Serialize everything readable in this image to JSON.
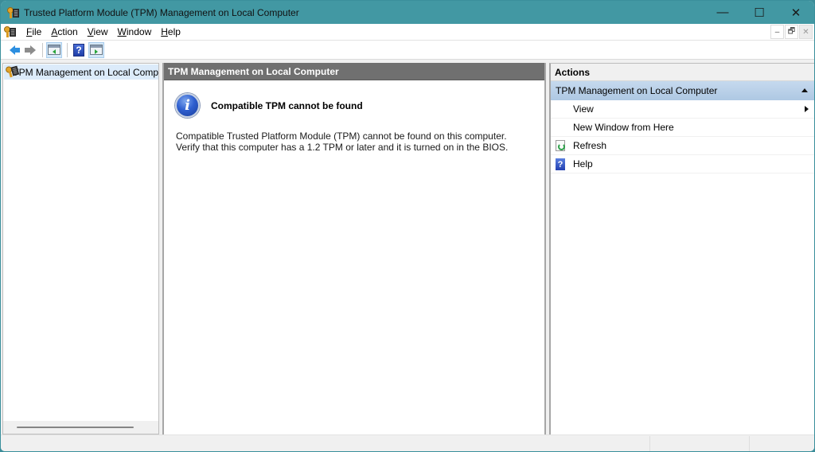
{
  "window": {
    "title": "Trusted Platform Module (TPM) Management on Local Computer",
    "caption_buttons": {
      "minimize": "—",
      "maximize": "☐",
      "close": "✕"
    },
    "accent_color": "#4298a3"
  },
  "menubar": {
    "items": [
      {
        "label": "File",
        "access_key": "F"
      },
      {
        "label": "Action",
        "access_key": "A"
      },
      {
        "label": "View",
        "access_key": "V"
      },
      {
        "label": "Window",
        "access_key": "W"
      },
      {
        "label": "Help",
        "access_key": "H"
      }
    ],
    "mdi_buttons": {
      "minimize": "–",
      "restore": "🗗",
      "close": "✕"
    }
  },
  "toolbar": {
    "buttons": [
      {
        "name": "back",
        "icon": "arrow-left-icon"
      },
      {
        "name": "forward",
        "icon": "arrow-right-icon"
      },
      {
        "name": "show-hide-console-tree",
        "icon": "console-tree-icon"
      },
      {
        "name": "help",
        "icon": "help-icon",
        "glyph": "?"
      },
      {
        "name": "show-hide-action-pane",
        "icon": "action-pane-icon"
      }
    ]
  },
  "tree": {
    "items": [
      {
        "label": "TPM Management on Local Comp",
        "icon": "tpm-key-icon",
        "selected": true
      }
    ]
  },
  "center": {
    "header": "TPM Management on Local Computer",
    "message_title": "Compatible TPM cannot be found",
    "message_body": "Compatible Trusted Platform Module (TPM) cannot be found on this computer. Verify that this computer has a 1.2 TPM or later and it is turned on in the BIOS.",
    "message_icon": "info-icon"
  },
  "actions": {
    "header": "Actions",
    "group_label": "TPM Management on Local Computer",
    "items": [
      {
        "label": "View",
        "icon": "",
        "has_submenu": true
      },
      {
        "label": "New Window from Here",
        "icon": "",
        "has_submenu": false
      },
      {
        "label": "Refresh",
        "icon": "refresh-icon",
        "has_submenu": false
      },
      {
        "label": "Help",
        "icon": "help-icon",
        "glyph": "?",
        "has_submenu": false
      }
    ]
  }
}
